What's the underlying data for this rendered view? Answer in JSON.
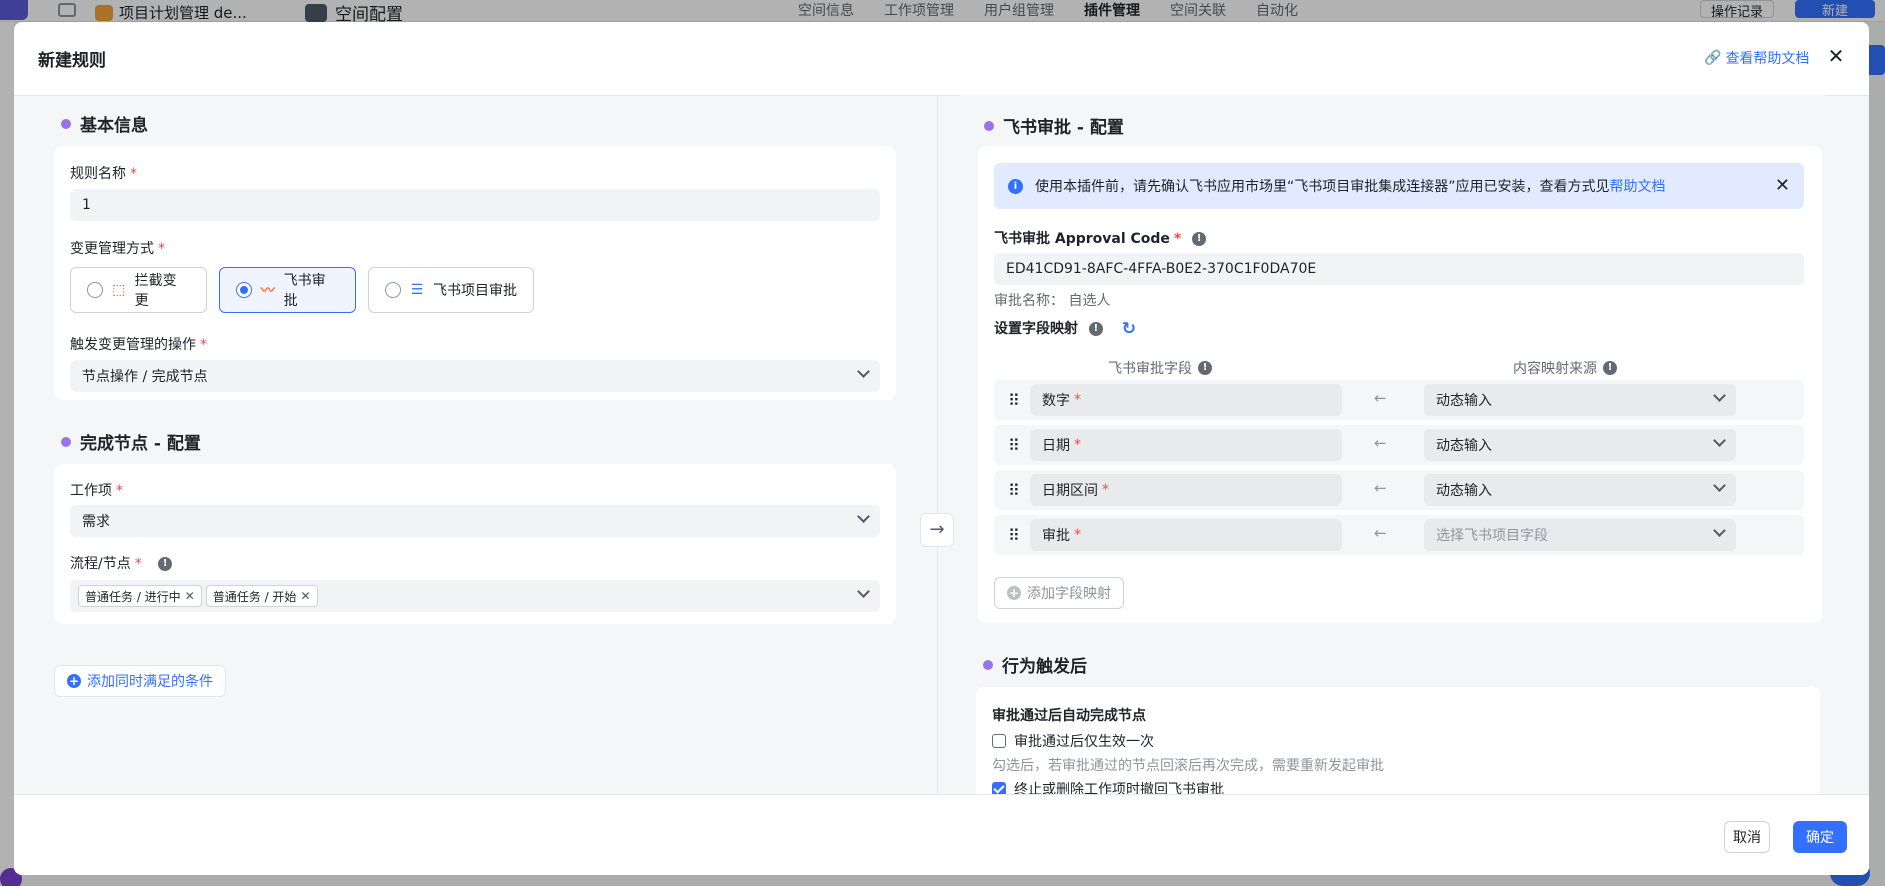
{
  "background": {
    "project_name": "项目计划管理 de...",
    "space_title": "空间配置",
    "tabs": [
      "空间信息",
      "工作项管理",
      "用户组管理",
      "插件管理",
      "空间关联",
      "自动化"
    ],
    "active_tab": "插件管理",
    "ops_button": "操作记录",
    "new_button": "新建"
  },
  "modal": {
    "title": "新建规则",
    "help_link": "查看帮助文档",
    "close_icon": "close-icon",
    "cancel_label": "取消",
    "ok_label": "确定"
  },
  "basic": {
    "heading": "基本信息",
    "rule_name_label": "规则名称",
    "rule_name_value": "1",
    "change_mode_label": "变更管理方式",
    "options": [
      {
        "label": "拦截变更",
        "icon": "intercept-icon",
        "selected": false
      },
      {
        "label": "飞书审批",
        "icon": "feishu-approval-icon",
        "selected": true
      },
      {
        "label": "飞书项目审批",
        "icon": "list-icon",
        "selected": false
      }
    ],
    "trigger_label": "触发变更管理的操作",
    "trigger_value": "节点操作 / 完成节点"
  },
  "complete_node": {
    "heading": "完成节点 - 配置",
    "work_item_label": "工作项",
    "work_item_value": "需求",
    "flow_label": "流程/节点",
    "flow_tags": [
      "普通任务 / 进行中",
      "普通任务 / 开始"
    ]
  },
  "add_condition": "添加同时满足的条件",
  "feishu_config": {
    "heading": "飞书审批 - 配置",
    "notice_text": "使用本插件前，请先确认飞书应用市场里“飞书项目审批集成连接器”应用已安装，查看方式见",
    "notice_link": "帮助文档",
    "approval_code_label": "飞书审批 Approval Code",
    "approval_code_value": "ED41CD91-8AFC-4FFA-B0E2-370C1F0DA70E",
    "approval_name": "审批名称：  自选人",
    "mapping_label": "设置字段映射",
    "col_field": "飞书审批字段",
    "col_source": "内容映射来源",
    "rows": [
      {
        "field": "数字",
        "source": "动态输入",
        "placeholder": false
      },
      {
        "field": "日期",
        "source": "动态输入",
        "placeholder": false
      },
      {
        "field": "日期区间",
        "source": "动态输入",
        "placeholder": false
      },
      {
        "field": "审批",
        "source": "选择飞书项目字段",
        "placeholder": true
      }
    ],
    "add_mapping": "添加字段映射"
  },
  "after_trigger": {
    "heading": "行为触发后",
    "sub_title": "审批通过后自动完成节点",
    "checkbox1_label": "审批通过后仅生效一次",
    "checkbox1_checked": false,
    "hint": "勾选后，若审批通过的节点回滚后再次完成，需要重新发起审批",
    "checkbox2_label": "终止或删除工作项时撤回飞书审批",
    "checkbox2_checked": true
  }
}
